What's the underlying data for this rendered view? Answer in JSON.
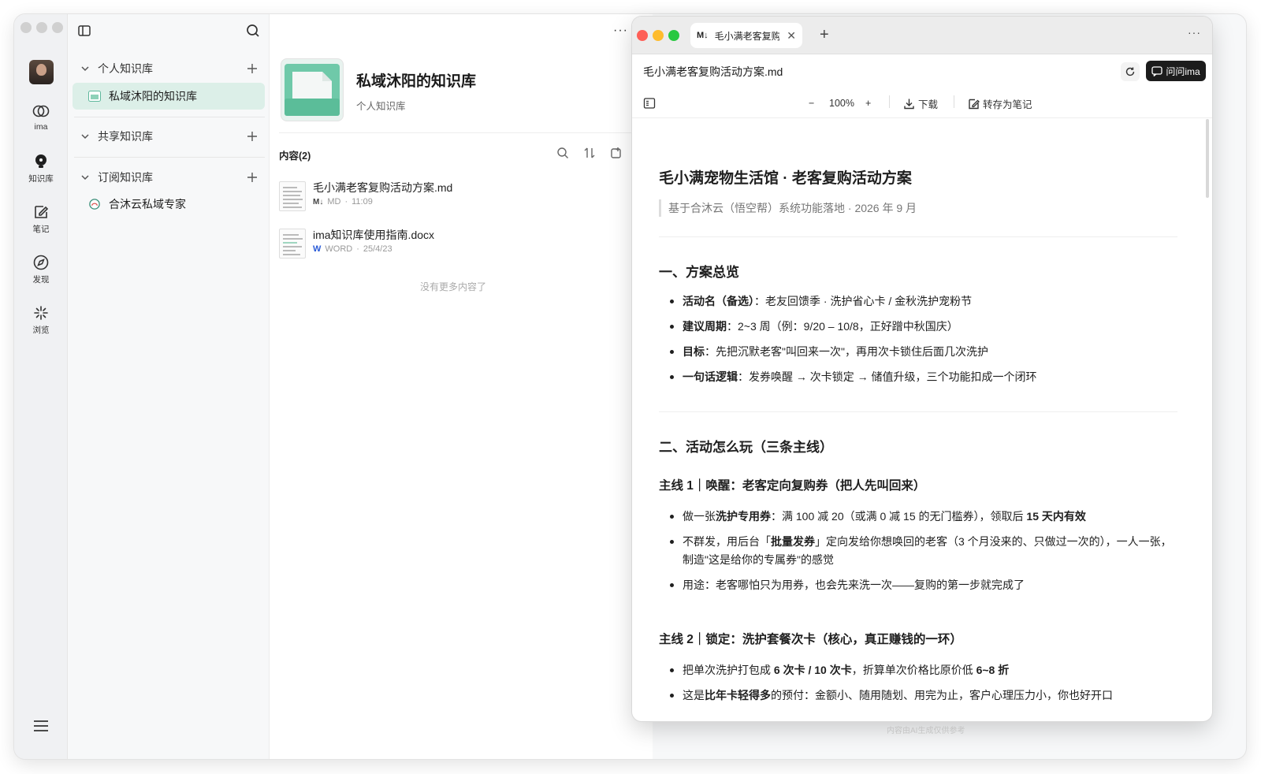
{
  "rail": {
    "items": [
      {
        "label": "ima"
      },
      {
        "label": "知识库"
      },
      {
        "label": "笔记"
      },
      {
        "label": "发现"
      },
      {
        "label": "浏览"
      }
    ]
  },
  "sidebar": {
    "groups": [
      {
        "label": "个人知识库"
      },
      {
        "label": "共享知识库"
      },
      {
        "label": "订阅知识库"
      }
    ],
    "personal_item": "私域沐阳的知识库",
    "subscribed_item": "合沐云私域专家"
  },
  "kb": {
    "title": "私域沐阳的知识库",
    "subtitle": "个人知识库",
    "content_count": "内容(2)",
    "files": [
      {
        "name": "毛小满老客复购活动方案.md",
        "type": "MD",
        "time": "11:09"
      },
      {
        "name": "ima知识库使用指南.docx",
        "type": "WORD",
        "time": "25/4/23"
      }
    ],
    "no_more": "没有更多内容了"
  },
  "viewer": {
    "tab_label": "毛小满老客复购活动方案.md",
    "file_title": "毛小满老客复购活动方案.md",
    "ask_label": "问问ima",
    "zoom": "100%",
    "download": "下载",
    "save_note": "转存为笔记"
  },
  "doc": {
    "h1": "毛小满宠物生活馆 · 老客复购活动方案",
    "quote": "基于合沐云（悟空帮）系统功能落地 · 2026 年 9 月",
    "s1_title": "一、方案总览",
    "s1_items": [
      {
        "b": "活动名（备选）",
        "t": "：老友回馈季 · 洗护省心卡 / 金秋洗护宠粉节"
      },
      {
        "b": "建议周期",
        "t": "：2~3 周（例：9/20 – 10/8，正好蹭中秋国庆）"
      },
      {
        "b": "目标",
        "t": "：先把沉默老客\"叫回来一次\"，再用次卡锁住后面几次洗护"
      },
      {
        "b": "一句话逻辑",
        "t": "：发券唤醒 → 次卡锁定 → 储值升级，三个功能扣成一个闭环"
      }
    ],
    "s2_title": "二、活动怎么玩（三条主线）",
    "m1_title": "主线 1｜唤醒：老客定向复购券（把人先叫回来）",
    "m1_li1": {
      "a": "做一张",
      "b": "洗护专用券",
      "c": "：满 100 减 20（或满 0 减 15 的无门槛券），领取后 ",
      "d": "15 天内有效"
    },
    "m1_li2": {
      "a": "不群发，用后台「",
      "b": "批量发券",
      "c": "」定向发给你想唤回的老客（3 个月没来的、只做过一次的），一人一张，制造\"这是给你的专属券\"的感觉"
    },
    "m1_li3": "用途：老客哪怕只为用券，也会先来洗一次——复购的第一步就完成了",
    "m2_title": "主线 2｜锁定：洗护套餐次卡（核心，真正赚钱的一环）",
    "m2_li1": {
      "a": "把单次洗护打包成 ",
      "b": "6 次卡 / 10 次卡",
      "c": "，折算单次价格比原价低 ",
      "d": "6~8 折"
    },
    "m2_li2": {
      "a": "这是",
      "b": "比年卡轻得多",
      "c": "的预付：金额小、随用随划、用完为止，客户心理压力小，你也好开口"
    }
  },
  "footer_note": "内容由AI生成仅供参考"
}
